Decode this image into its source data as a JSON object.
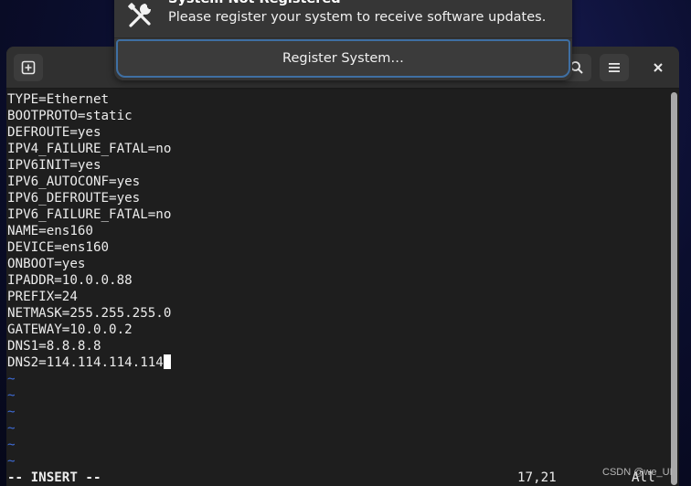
{
  "notification": {
    "title": "System Not Registered",
    "body": "Please register your system to receive software updates.",
    "action_label": "Register System…",
    "icon": "tools-icon"
  },
  "terminal": {
    "buttons": {
      "new_tab": "new-tab-icon",
      "search": "search-icon",
      "menu": "hamburger-menu-icon",
      "close": "close-icon"
    },
    "lines": [
      "TYPE=Ethernet",
      "BOOTPROTO=static",
      "DEFROUTE=yes",
      "IPV4_FAILURE_FATAL=no",
      "IPV6INIT=yes",
      "IPV6_AUTOCONF=yes",
      "IPV6_DEFROUTE=yes",
      "IPV6_FAILURE_FATAL=no",
      "NAME=ens160",
      "DEVICE=ens160",
      "ONBOOT=yes",
      "IPADDR=10.0.0.88",
      "PREFIX=24",
      "NETMASK=255.255.255.0",
      "GATEWAY=10.0.0.2",
      "DNS1=8.8.8.8",
      "DNS2=114.114.114.114"
    ],
    "tildes": [
      "~",
      "~",
      "~",
      "~",
      "~",
      "~"
    ],
    "status": {
      "mode": "-- INSERT --",
      "position": "17,21",
      "scroll": "All"
    }
  },
  "watermark": "CSDN @we_UI",
  "colors": {
    "terminal_bg": "#1e1e1e",
    "text": "#ececec",
    "tilde": "#3e6bd6",
    "notification_bg": "#363636",
    "focus_border": "#3f6fa3"
  }
}
